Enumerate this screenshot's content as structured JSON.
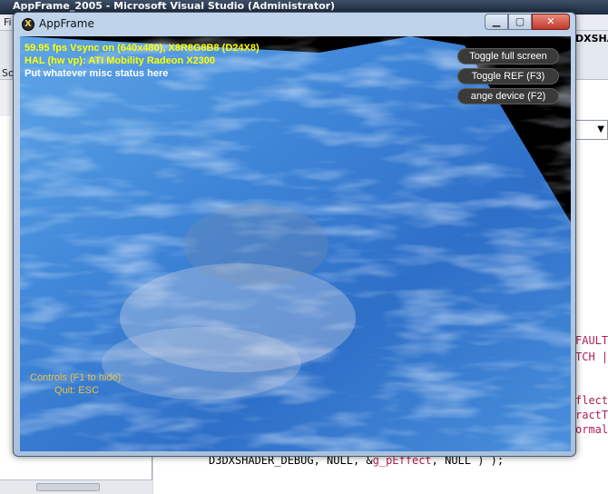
{
  "vs": {
    "title": "AppFrame_2005 - Microsoft Visual Studio (Administrator)",
    "menu_partial": "Fi",
    "solution_partial": "Sol",
    "right_tab_partial": "DXSHA",
    "code_lines": [
      {
        "text": "FAULT",
        "color": "#b0205a"
      },
      {
        "text": "TCH | I",
        "color": "#b0205a"
      },
      {
        "text": "flectTe",
        "color": "#b0205a"
      },
      {
        "text": "ractTe",
        "color": "#b0205a"
      },
      {
        "text": "ormalT",
        "color": "#b0205a"
      }
    ],
    "bottom_code": {
      "part1": "D3DXSHADER_DEBUG, NULL, &",
      "part2": "g_pEffect",
      "part3": ", NULL ) );"
    },
    "colors": {
      "keyword": "#b0205a",
      "variable": "#b0205a",
      "text": "#000000"
    }
  },
  "app": {
    "title": "AppFrame",
    "icon": "directx-x-icon",
    "caption_buttons": [
      "minimize-icon",
      "maximize-icon",
      "close-icon"
    ],
    "stats": {
      "line1": "59.95 fps Vsync on (640x480), X8R8G8B8 (D24X8)",
      "line2": "HAL (hw vp): ATI Mobility Radeon X2300",
      "line3": "Put whatever misc status here"
    },
    "buttons": {
      "fullscreen": "Toggle full screen",
      "ref": "Toggle REF (F3)",
      "device": "ange device (F2)"
    },
    "controls": {
      "line1": "Controls (F1 to hide):",
      "line2": "Quit: ESC"
    },
    "colors": {
      "stat_yellow": "#ffff00",
      "stat_white": "#ffffff",
      "controls": "#e8c04a"
    }
  }
}
